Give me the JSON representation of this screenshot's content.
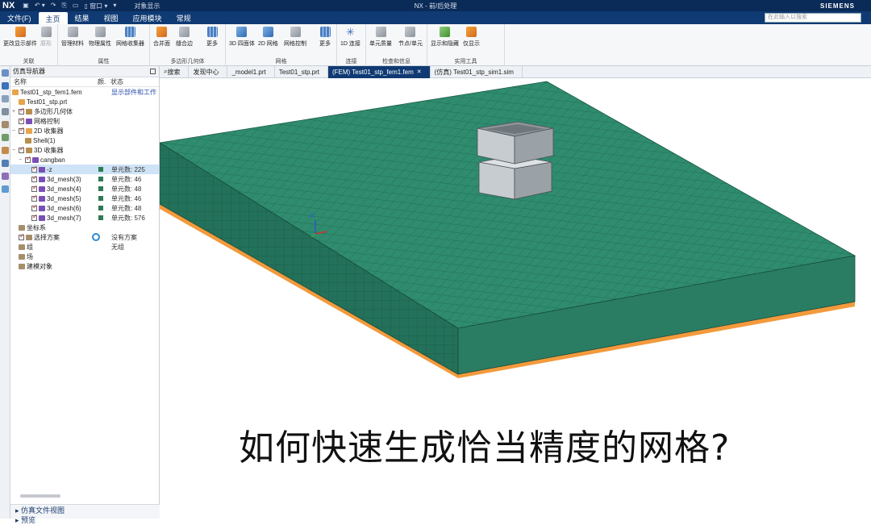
{
  "titlebar": {
    "logo": "NX",
    "quick_access": [
      "▣",
      "↶ ▾",
      "↷",
      "⎘",
      "▭",
      "▯ 窗口 ▾",
      "▾"
    ],
    "context_label": "对象显示",
    "title": "NX - 前/后处理",
    "brand": "SIEMENS"
  },
  "menu": {
    "tabs": [
      "文件(F)",
      "主页",
      "结果",
      "视图",
      "应用模块",
      "常规"
    ],
    "active_tab": "主页",
    "search_placeholder": "在此输入以搜索"
  },
  "ribbon": {
    "groups": [
      {
        "label": "关联",
        "buttons": [
          "更改显示部件",
          "原形"
        ]
      },
      {
        "label": "属性",
        "buttons": [
          "管理材料",
          "物理属性",
          "网格收集器"
        ]
      },
      {
        "label": "多边形几何体",
        "buttons": [
          "合并面",
          "缝合边",
          "更多"
        ]
      },
      {
        "label": "网格",
        "buttons": [
          "3D 四面体",
          "2D 网格",
          "网格控制",
          "更多"
        ]
      },
      {
        "label": "连接",
        "buttons": [
          "1D 连接"
        ]
      },
      {
        "label": "检查和信息",
        "buttons": [
          "单元质量",
          "节点/单元"
        ]
      },
      {
        "label": "实用工具",
        "buttons": [
          "显示和隐藏",
          "仅显示"
        ]
      }
    ]
  },
  "tabs_bar": {
    "items": [
      "搜索",
      "发现中心",
      "_model1.prt",
      "Test01_stp.prt",
      "(FEM) Test01_stp_fem1.fem",
      "(仿真) Test01_stp_sim1.sim"
    ],
    "active": "(FEM) Test01_stp_fem1.fem"
  },
  "navigator": {
    "title": "仿真导航器",
    "columns": [
      "名称",
      "颜.",
      "状态"
    ],
    "rows": [
      {
        "name": "Test01_stp_fem1.fem",
        "state": "显示部件和工作",
        "state_blue": true
      },
      {
        "name": "Test01_stp.prt"
      },
      {
        "name": "多边形几何体"
      },
      {
        "name": "网格控制"
      },
      {
        "name": "2D 收集器"
      },
      {
        "name": "Shell(1)"
      },
      {
        "name": "3D 收集器"
      },
      {
        "name": "cangban"
      },
      {
        "name": "-z",
        "state": "单元数: 225",
        "swatch": true,
        "selected": true
      },
      {
        "name": "3d_mesh(3)",
        "state": "单元数: 46",
        "swatch": true
      },
      {
        "name": "3d_mesh(4)",
        "state": "单元数: 48",
        "swatch": true
      },
      {
        "name": "3d_mesh(5)",
        "state": "单元数: 46",
        "swatch": true
      },
      {
        "name": "3d_mesh(6)",
        "state": "单元数: 48",
        "swatch": true
      },
      {
        "name": "3d_mesh(7)",
        "state": "单元数: 576",
        "swatch": true
      },
      {
        "name": "坐标系"
      },
      {
        "name": "选择方案",
        "state": "没有方案"
      },
      {
        "name": "组",
        "state": "无组"
      },
      {
        "name": "场"
      },
      {
        "name": "建模对象"
      }
    ],
    "bottom_panels": [
      "仿真文件视图",
      "预览"
    ]
  },
  "viewport": {
    "axis_label": "ZC",
    "colors": {
      "mesh": "#2f8c6e",
      "mesh_dark": "#23715a",
      "grid_line": "#1c5a47",
      "base_plate": "#f39a3c",
      "box": "#b9bec3"
    }
  },
  "caption": "如何快速生成恰当精度的网格?"
}
